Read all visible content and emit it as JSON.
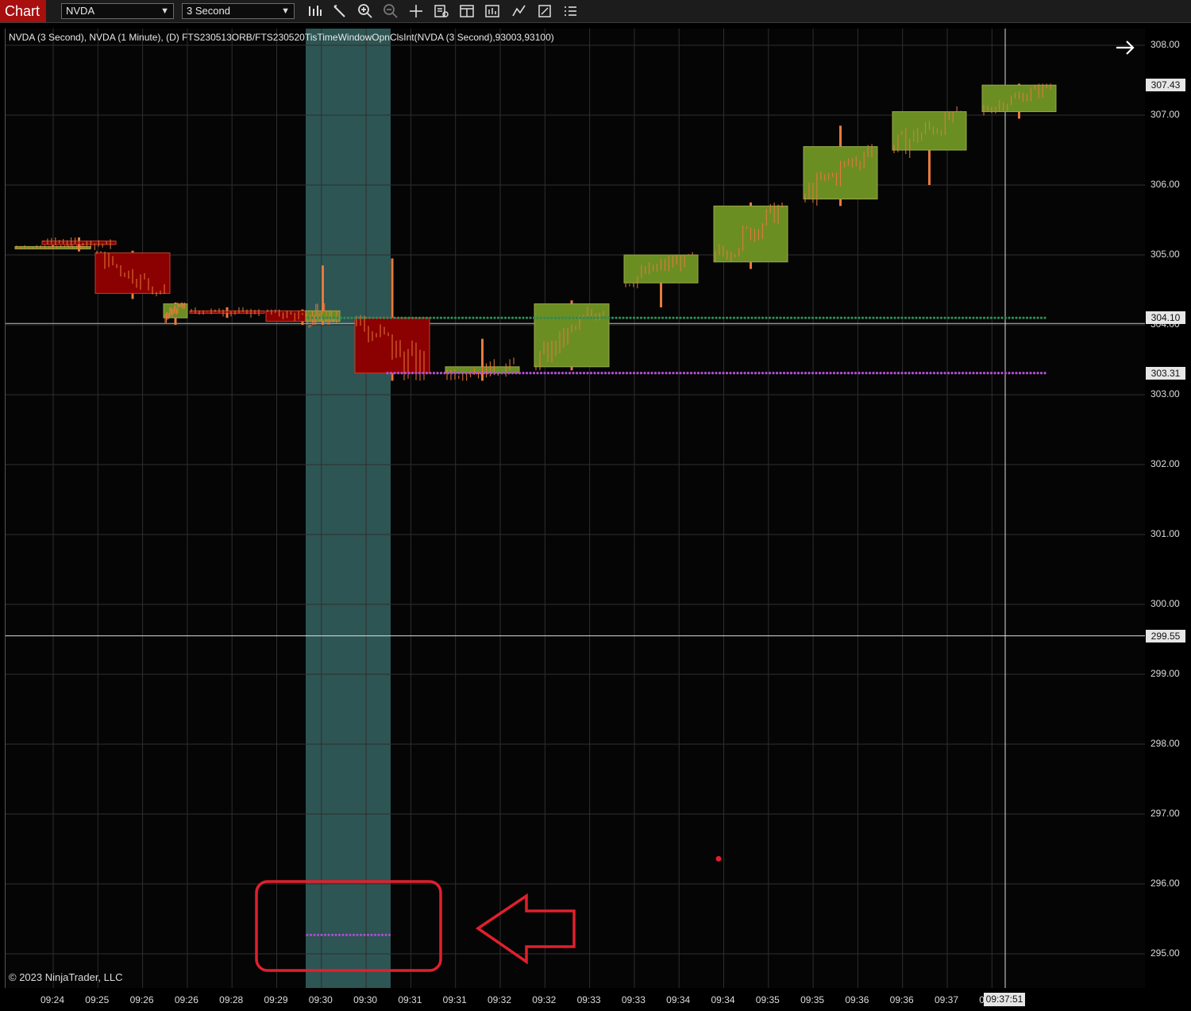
{
  "toolbar": {
    "app_tab": "Chart",
    "instrument": "NVDA",
    "interval": "3 Second",
    "icons": [
      "bar-chart-icon",
      "pencil-icon",
      "zoom-in-icon",
      "zoom-out-icon",
      "crosshair-icon",
      "data-box-icon",
      "properties-icon",
      "indicators-icon",
      "strategies-icon",
      "templates-icon",
      "menu-icon"
    ]
  },
  "chart": {
    "title": "NVDA (3 Second), NVDA (1 Minute), (D) FTS230513ORB/FTS230520TisTimeWindowOpnClsInt(NVDA (3 Second),93003,93100)",
    "copyright": "© 2023 NinjaTrader, LLC",
    "y_ticks": [
      "308.00",
      "307.00",
      "306.00",
      "305.00",
      "304.00",
      "303.00",
      "302.00",
      "301.00",
      "300.00",
      "299.00",
      "298.00",
      "297.00",
      "296.00",
      "295.00"
    ],
    "price_markers": [
      {
        "label": "307.43",
        "price": 307.43
      },
      {
        "label": "304.10",
        "price": 304.1
      },
      {
        "label": "303.31",
        "price": 303.31
      },
      {
        "label": "299.55",
        "price": 299.55
      }
    ],
    "x_ticks": [
      "09:24",
      "09:25",
      "09:26",
      "09:26",
      "09:28",
      "09:29",
      "09:30",
      "09:30",
      "09:31",
      "09:31",
      "09:32",
      "09:32",
      "09:33",
      "09:33",
      "09:34",
      "09:34",
      "09:35",
      "09:35",
      "09:36",
      "09:36",
      "09:37",
      "09:38"
    ],
    "cursor_time": "09:37:51",
    "colors": {
      "up": "#6b8e23",
      "down": "#8b0000",
      "wick": "#e87a3c",
      "session": "#2f5a58",
      "open_line": "#2e8b57",
      "close_line": "#b44fd6",
      "annotation": "#e0202c"
    }
  },
  "chart_data": {
    "type": "candlestick",
    "interval": "1 Minute",
    "ylim": [
      294.6,
      308.2
    ],
    "minute_bars": [
      {
        "t": "09:24",
        "o": 305.1,
        "h": 305.14,
        "l": 305.08,
        "c": 305.12
      },
      {
        "t": "09:25",
        "o": 305.2,
        "h": 305.25,
        "l": 305.05,
        "c": 305.15
      },
      {
        "t": "09:26",
        "o": 305.03,
        "h": 305.06,
        "l": 304.37,
        "c": 304.45
      },
      {
        "t": "09:27",
        "o": 304.1,
        "h": 304.32,
        "l": 304.0,
        "c": 304.3
      },
      {
        "t": "09:28",
        "o": 304.2,
        "h": 304.25,
        "l": 304.1,
        "c": 304.18
      },
      {
        "t": "09:29",
        "o": 304.2,
        "h": 304.22,
        "l": 304.0,
        "c": 304.05
      },
      {
        "t": "09:30",
        "o": 304.05,
        "h": 304.85,
        "l": 304.0,
        "c": 304.2
      },
      {
        "t": "09:31",
        "o": 304.1,
        "h": 304.95,
        "l": 303.2,
        "c": 303.31
      },
      {
        "t": "09:32",
        "o": 303.31,
        "h": 303.8,
        "l": 303.2,
        "c": 303.4
      },
      {
        "t": "09:33",
        "o": 303.4,
        "h": 304.35,
        "l": 303.35,
        "c": 304.3
      },
      {
        "t": "09:34",
        "o": 304.6,
        "h": 305.0,
        "l": 304.25,
        "c": 305.0
      },
      {
        "t": "09:35",
        "o": 304.9,
        "h": 305.75,
        "l": 304.8,
        "c": 305.7
      },
      {
        "t": "09:36",
        "o": 305.8,
        "h": 306.85,
        "l": 305.7,
        "c": 306.55
      },
      {
        "t": "09:37",
        "o": 306.5,
        "h": 307.05,
        "l": 306.0,
        "c": 307.05
      },
      {
        "t": "09:38",
        "o": 307.05,
        "h": 307.45,
        "l": 306.95,
        "c": 307.43
      }
    ],
    "open_line": 304.1,
    "close_line": 303.31,
    "session_window": [
      "09:30:03",
      "09:31:00"
    ],
    "drawn_value_in_window": 295.27,
    "stray_dot": 296.36
  }
}
